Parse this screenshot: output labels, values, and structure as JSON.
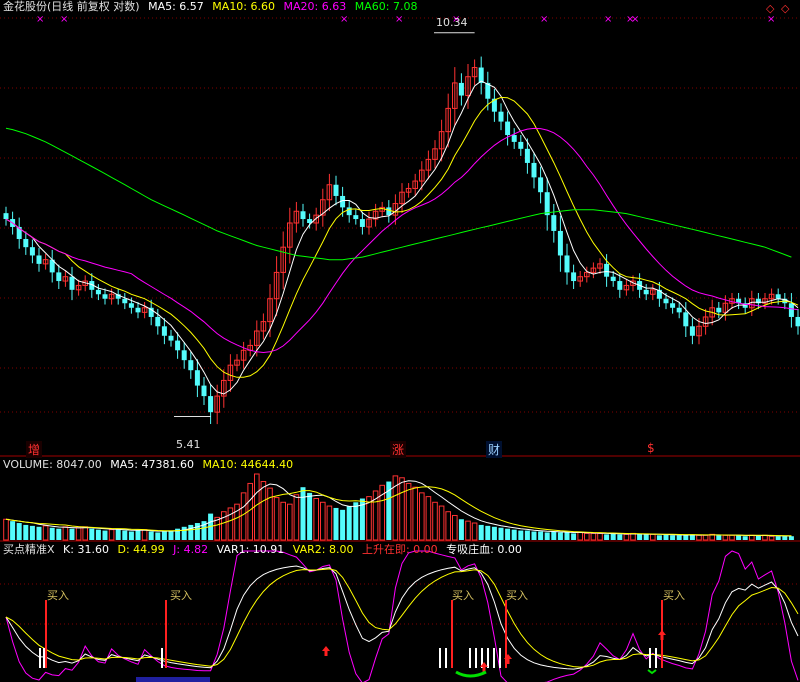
{
  "header": {
    "stock_name": "金花股份(日线 前复权 对数)",
    "ma5": "MA5: 6.57",
    "ma10": "MA10: 6.60",
    "ma20": "MA20: 6.63",
    "ma60": "MA60: 7.08"
  },
  "price_annotations": {
    "high": "10.34",
    "low": "5.41"
  },
  "event_markers": {
    "zeng": "增",
    "zhang": "涨",
    "cai": "财",
    "dollar": "$"
  },
  "volume_header": {
    "volume": "VOLUME: 8047.00",
    "ma5": "MA5: 47381.60",
    "ma10": "MA10: 44644.40"
  },
  "indicator_header": {
    "name": "买点精准X",
    "k": "K: 31.60",
    "d": "D: 44.99",
    "j": "J: 4.82",
    "var1": "VAR1: 10.91",
    "var2": "VAR2: 8.00",
    "rise": "上升在即: 0.00",
    "absorb": "专吸庄血: 0.00"
  },
  "buy_label": "买入",
  "colors": {
    "up": "#ff3232",
    "down": "#54fcfc",
    "ma5": "#ffffff",
    "ma10": "#ffff00",
    "ma20": "#ff00ff",
    "ma60": "#00ff00",
    "grid": "#800000"
  },
  "chart_data": {
    "type": "candlestick",
    "price_range": [
      5.2,
      10.6
    ],
    "high": 10.34,
    "low": 5.41,
    "closes": [
      7.55,
      7.45,
      7.3,
      7.2,
      7.1,
      7.0,
      7.05,
      6.9,
      6.8,
      6.85,
      6.7,
      6.75,
      6.8,
      6.7,
      6.65,
      6.6,
      6.65,
      6.6,
      6.55,
      6.5,
      6.45,
      6.5,
      6.4,
      6.3,
      6.2,
      6.15,
      6.05,
      5.95,
      5.85,
      5.7,
      5.6,
      5.45,
      5.6,
      5.75,
      5.9,
      5.95,
      6.05,
      6.1,
      6.25,
      6.35,
      6.6,
      6.9,
      7.2,
      7.5,
      7.65,
      7.55,
      7.5,
      7.6,
      7.8,
      8.0,
      7.85,
      7.7,
      7.6,
      7.55,
      7.45,
      7.55,
      7.65,
      7.7,
      7.6,
      7.75,
      7.9,
      7.95,
      8.05,
      8.2,
      8.35,
      8.5,
      8.75,
      9.1,
      9.5,
      9.3,
      9.6,
      9.75,
      9.5,
      9.25,
      9.05,
      8.9,
      8.7,
      8.6,
      8.5,
      8.3,
      8.1,
      7.9,
      7.6,
      7.4,
      7.1,
      6.9,
      6.8,
      6.85,
      6.9,
      6.95,
      7.0,
      6.85,
      6.8,
      6.7,
      6.75,
      6.8,
      6.7,
      6.65,
      6.7,
      6.6,
      6.55,
      6.5,
      6.45,
      6.3,
      6.2,
      6.3,
      6.4,
      6.5,
      6.45,
      6.55,
      6.6,
      6.55,
      6.5,
      6.6,
      6.55,
      6.6,
      6.65,
      6.6,
      6.55,
      6.4,
      6.3
    ],
    "volumes": [
      22,
      20,
      18,
      16,
      15,
      14,
      15,
      13,
      12,
      14,
      12,
      13,
      14,
      12,
      11,
      10,
      11,
      12,
      10,
      9,
      10,
      11,
      9,
      8,
      9,
      10,
      12,
      14,
      16,
      18,
      20,
      28,
      24,
      30,
      34,
      38,
      50,
      60,
      70,
      62,
      55,
      45,
      40,
      38,
      48,
      56,
      50,
      44,
      40,
      36,
      34,
      32,
      36,
      40,
      44,
      46,
      52,
      58,
      62,
      68,
      66,
      60,
      56,
      50,
      46,
      40,
      36,
      30,
      26,
      22,
      20,
      18,
      16,
      15,
      14,
      13,
      12,
      11,
      10,
      10,
      9,
      9,
      8,
      9,
      8,
      8,
      7,
      8,
      7,
      7,
      7,
      6,
      7,
      6,
      6,
      7,
      6,
      6,
      6,
      5,
      6,
      5,
      5,
      5,
      6,
      5,
      5,
      6,
      5,
      5,
      5,
      5,
      4,
      5,
      5,
      5,
      4,
      4,
      4,
      4
    ],
    "ma60": [
      8.8,
      8.78,
      8.75,
      8.72,
      8.68,
      8.64,
      8.6,
      8.55,
      8.5,
      8.45,
      8.4,
      8.35,
      8.3,
      8.25,
      8.2,
      8.15,
      8.1,
      8.05,
      8.0,
      7.95,
      7.9,
      7.85,
      7.8,
      7.76,
      7.72,
      7.68,
      7.64,
      7.6,
      7.56,
      7.52,
      7.48,
      7.44,
      7.4,
      7.37,
      7.34,
      7.31,
      7.28,
      7.25,
      7.22,
      7.2,
      7.18,
      7.16,
      7.14,
      7.12,
      7.1,
      7.09,
      7.08,
      7.07,
      7.06,
      7.05,
      7.05,
      7.05,
      7.06,
      7.07,
      7.08,
      7.1,
      7.12,
      7.14,
      7.16,
      7.18,
      7.2,
      7.22,
      7.24,
      7.26,
      7.28,
      7.3,
      7.32,
      7.34,
      7.36,
      7.38,
      7.4,
      7.42,
      7.44,
      7.46,
      7.48,
      7.5,
      7.52,
      7.54,
      7.56,
      7.58,
      7.6,
      7.62,
      7.63,
      7.64,
      7.65,
      7.66,
      7.67,
      7.67,
      7.67,
      7.67,
      7.66,
      7.65,
      7.64,
      7.63,
      7.62,
      7.6,
      7.58,
      7.56,
      7.54,
      7.52,
      7.5,
      7.48,
      7.46,
      7.44,
      7.42,
      7.4,
      7.38,
      7.36,
      7.34,
      7.32,
      7.3,
      7.28,
      7.26,
      7.24,
      7.22,
      7.2,
      7.17,
      7.14,
      7.11,
      7.08
    ]
  }
}
